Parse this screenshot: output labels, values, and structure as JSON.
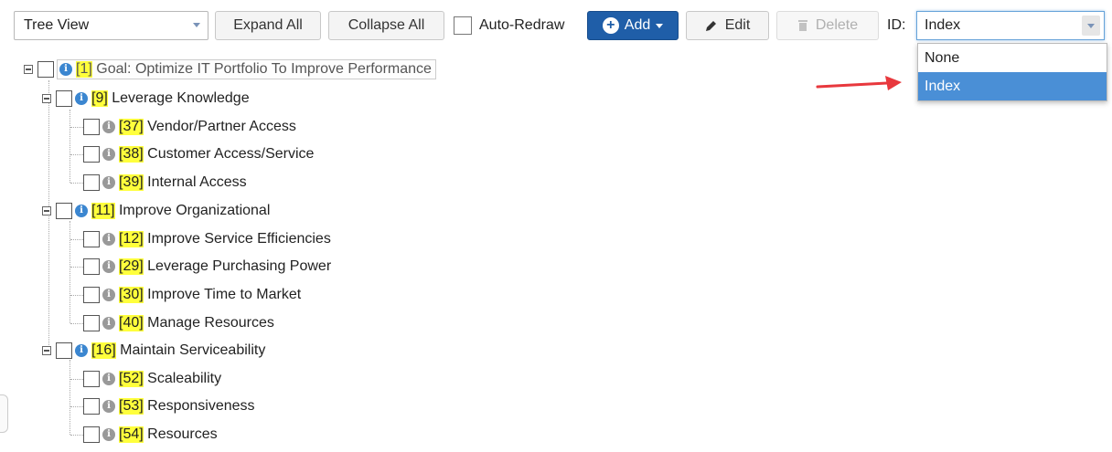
{
  "toolbar": {
    "view_select": "Tree View",
    "expand_all": "Expand All",
    "collapse_all": "Collapse All",
    "auto_redraw": "Auto-Redraw",
    "add": "Add",
    "edit": "Edit",
    "delete": "Delete",
    "id_label": "ID:",
    "id_select": "Index"
  },
  "id_dropdown": {
    "options": [
      "None",
      "Index"
    ],
    "selected": "Index"
  },
  "tree": {
    "root": {
      "id": "[1]",
      "label": "Goal: Optimize IT Portfolio To Improve Performance"
    },
    "groups": [
      {
        "id": "[9]",
        "label": "Leverage Knowledge",
        "children": [
          {
            "id": "[37]",
            "label": "Vendor/Partner Access"
          },
          {
            "id": "[38]",
            "label": "Customer Access/Service"
          },
          {
            "id": "[39]",
            "label": "Internal Access"
          }
        ]
      },
      {
        "id": "[11]",
        "label": "Improve Organizational",
        "children": [
          {
            "id": "[12]",
            "label": "Improve Service Efficiencies"
          },
          {
            "id": "[29]",
            "label": "Leverage Purchasing Power"
          },
          {
            "id": "[30]",
            "label": "Improve Time to Market"
          },
          {
            "id": "[40]",
            "label": "Manage Resources"
          }
        ]
      },
      {
        "id": "[16]",
        "label": "Maintain Serviceability",
        "children": [
          {
            "id": "[52]",
            "label": "Scaleability"
          },
          {
            "id": "[53]",
            "label": "Responsiveness"
          },
          {
            "id": "[54]",
            "label": "Resources"
          }
        ]
      }
    ]
  },
  "colors": {
    "highlight": "#ffff3c",
    "primary": "#1f5ea8",
    "arrow": "#e8383d",
    "info_active": "#3b86d0",
    "info_leaf": "#999999"
  },
  "icons": [
    "plus-circle-icon",
    "pencil-icon",
    "trash-icon",
    "info-icon",
    "collapse-icon",
    "arrow-icon"
  ]
}
